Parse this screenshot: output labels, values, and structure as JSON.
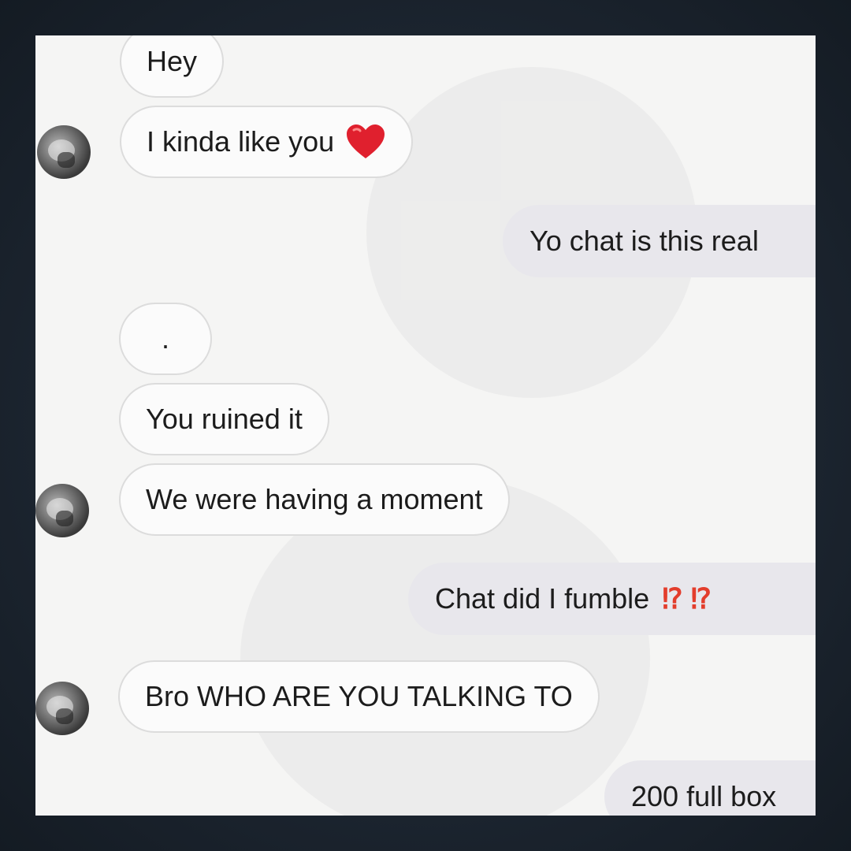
{
  "messages": [
    {
      "sender": "them",
      "text": "Hey"
    },
    {
      "sender": "them",
      "text": "I kinda like you",
      "emoji": "red-heart"
    },
    {
      "sender": "me",
      "text": "Yo chat is this real"
    },
    {
      "sender": "them",
      "text": "."
    },
    {
      "sender": "them",
      "text": "You ruined it"
    },
    {
      "sender": "them",
      "text": "We were having a moment"
    },
    {
      "sender": "me",
      "text": "Chat did I fumble",
      "suffix": [
        "⁉",
        "⁉"
      ]
    },
    {
      "sender": "them",
      "text": "Bro WHO ARE YOU TALKING TO"
    },
    {
      "sender": "me",
      "text": "200 full box"
    }
  ],
  "colors": {
    "incoming_bubble": "#fbfbfb",
    "outgoing_bubble": "#e8e7ec",
    "punctuation_red": "#e33d2c",
    "heart_red": "#e0202e"
  },
  "icons": [
    "avatar",
    "red-heart-icon",
    "interrobang-icon"
  ]
}
